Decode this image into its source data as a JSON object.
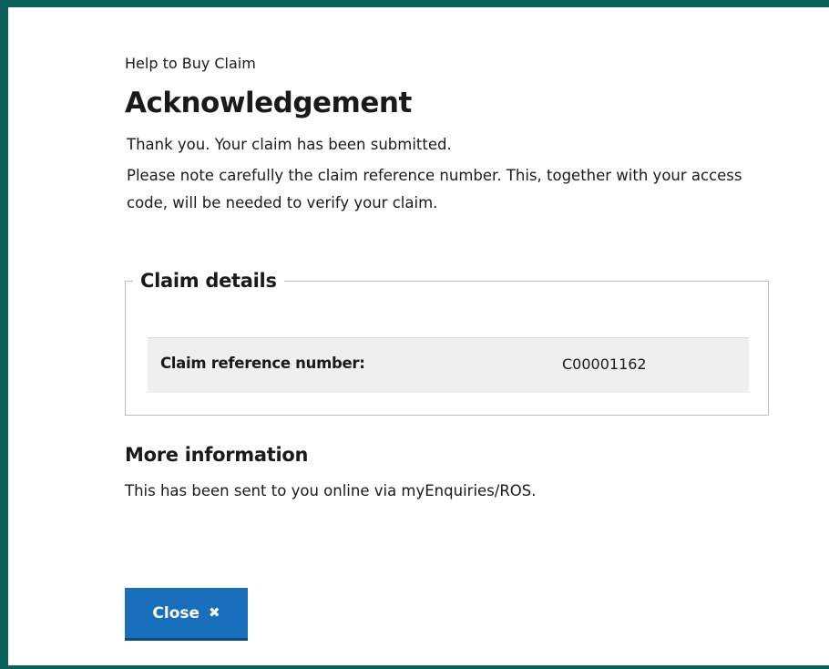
{
  "page": {
    "kicker": "Help to Buy Claim",
    "title": "Acknowledgement",
    "paragraphs": [
      "Thank you. Your claim has been submitted.",
      "Please note carefully the claim reference number. This, together with your access code, will be needed to verify your claim."
    ]
  },
  "claim_details": {
    "legend": "Claim details",
    "label": "Claim reference number:",
    "value": "C00001162"
  },
  "more_information": {
    "heading": "More information",
    "text": "This has been sent to you online via myEnquiries/ROS."
  },
  "actions": {
    "close_label": "Close",
    "close_icon": "close-x-icon"
  },
  "colors": {
    "frame": "#0b5f5a",
    "button": "#1a6fbd",
    "row_background": "#efefef"
  }
}
